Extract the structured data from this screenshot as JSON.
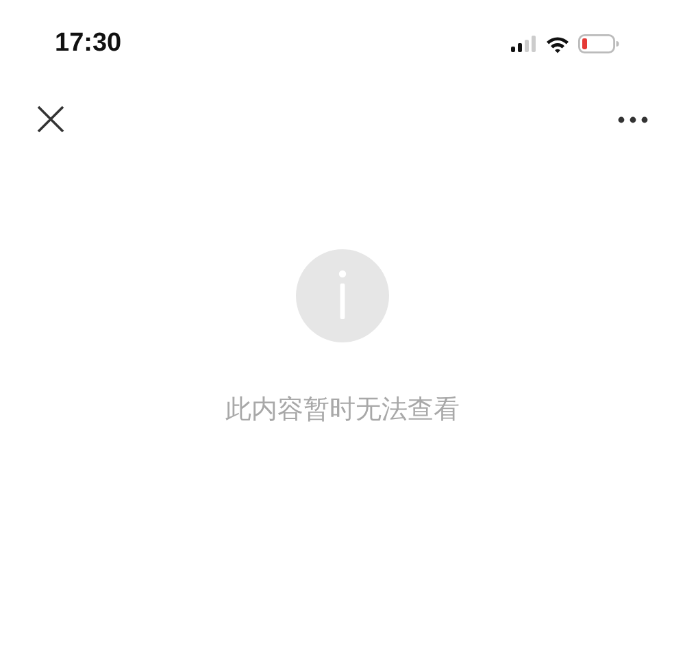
{
  "status_bar": {
    "time": "17:30"
  },
  "message": {
    "text": "此内容暂时无法查看"
  }
}
